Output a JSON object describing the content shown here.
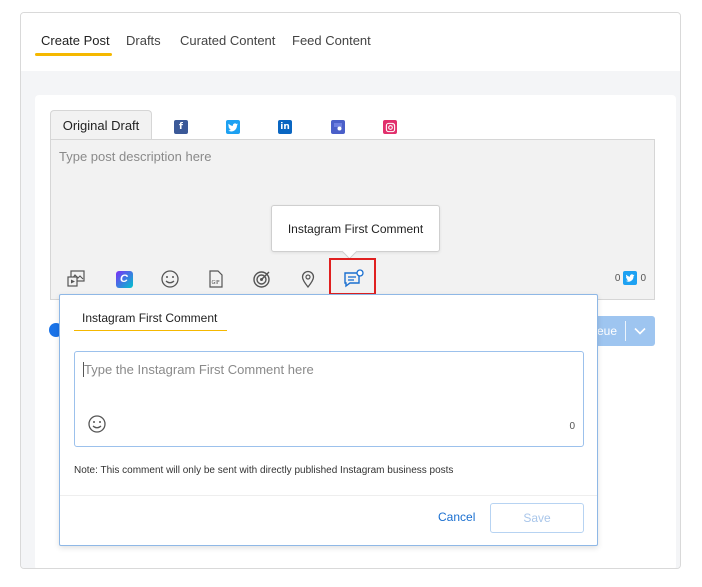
{
  "tabs": [
    {
      "label": "Create Post",
      "active": true
    },
    {
      "label": "Drafts"
    },
    {
      "label": "Curated Content"
    },
    {
      "label": "Feed Content"
    }
  ],
  "editor": {
    "draft_tab_label": "Original Draft",
    "networks": [
      "facebook-icon",
      "twitter-icon",
      "linkedin-icon",
      "google-business-icon",
      "instagram-icon"
    ],
    "placeholder": "Type post description here",
    "char_count": "0",
    "twitter_count": "0",
    "toolbar_icons": [
      "media-library-icon",
      "canva-icon",
      "emoji-icon",
      "gif-icon",
      "target-icon",
      "location-icon",
      "first-comment-icon"
    ]
  },
  "tooltip": {
    "text": "Instagram First Comment"
  },
  "queue_button": {
    "label": "eue"
  },
  "first_comment": {
    "title": "Instagram First Comment",
    "placeholder": "Type the Instagram First Comment here",
    "count": "0",
    "note": "Note: This comment will only be sent with directly published Instagram business posts",
    "cancel_label": "Cancel",
    "save_label": "Save"
  },
  "colors": {
    "accent_yellow": "#f5b800",
    "primary_blue": "#1a73e8",
    "highlight_red": "#e02020",
    "facebook": "#3b5998",
    "twitter": "#1da1f2",
    "linkedin": "#0a66c2",
    "instagram": "#e1306c"
  }
}
